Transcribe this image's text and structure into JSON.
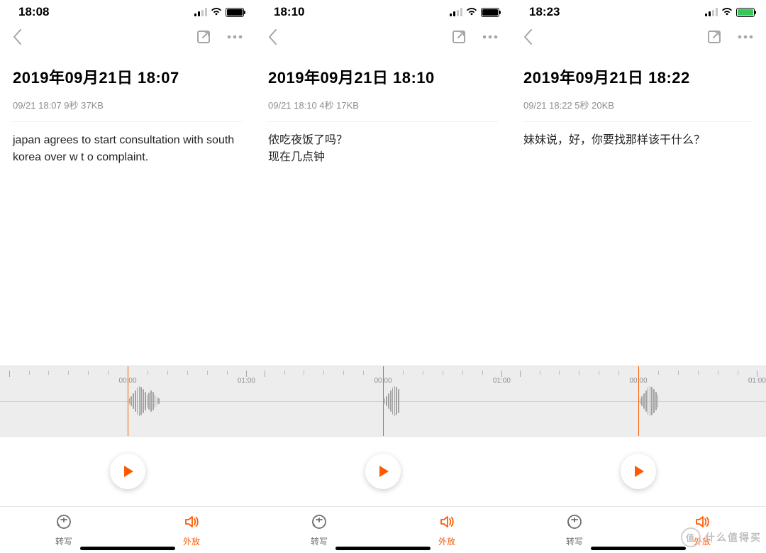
{
  "timeline": {
    "labels": [
      "00:00",
      "01:00"
    ]
  },
  "controls": {
    "transcribe_label": "转写",
    "speaker_label": "外放"
  },
  "watermark": "什么值得买",
  "panes": [
    {
      "status_time": "18:08",
      "battery_state": "full",
      "title": "2019年09月21日 18:07",
      "meta": "09/21 18:07 9秒 37KB",
      "transcript": "japan agrees to start consultation with south korea over w t o complaint."
    },
    {
      "status_time": "18:10",
      "battery_state": "full",
      "title": "2019年09月21日 18:10",
      "meta": "09/21 18:10 4秒 17KB",
      "transcript": "侬吃夜饭了吗？\n现在几点钟"
    },
    {
      "status_time": "18:23",
      "battery_state": "charging",
      "title": "2019年09月21日 18:22",
      "meta": "09/21 18:22 5秒 20KB",
      "transcript": "妹妹说，好，你要找那样该干什么？"
    }
  ]
}
